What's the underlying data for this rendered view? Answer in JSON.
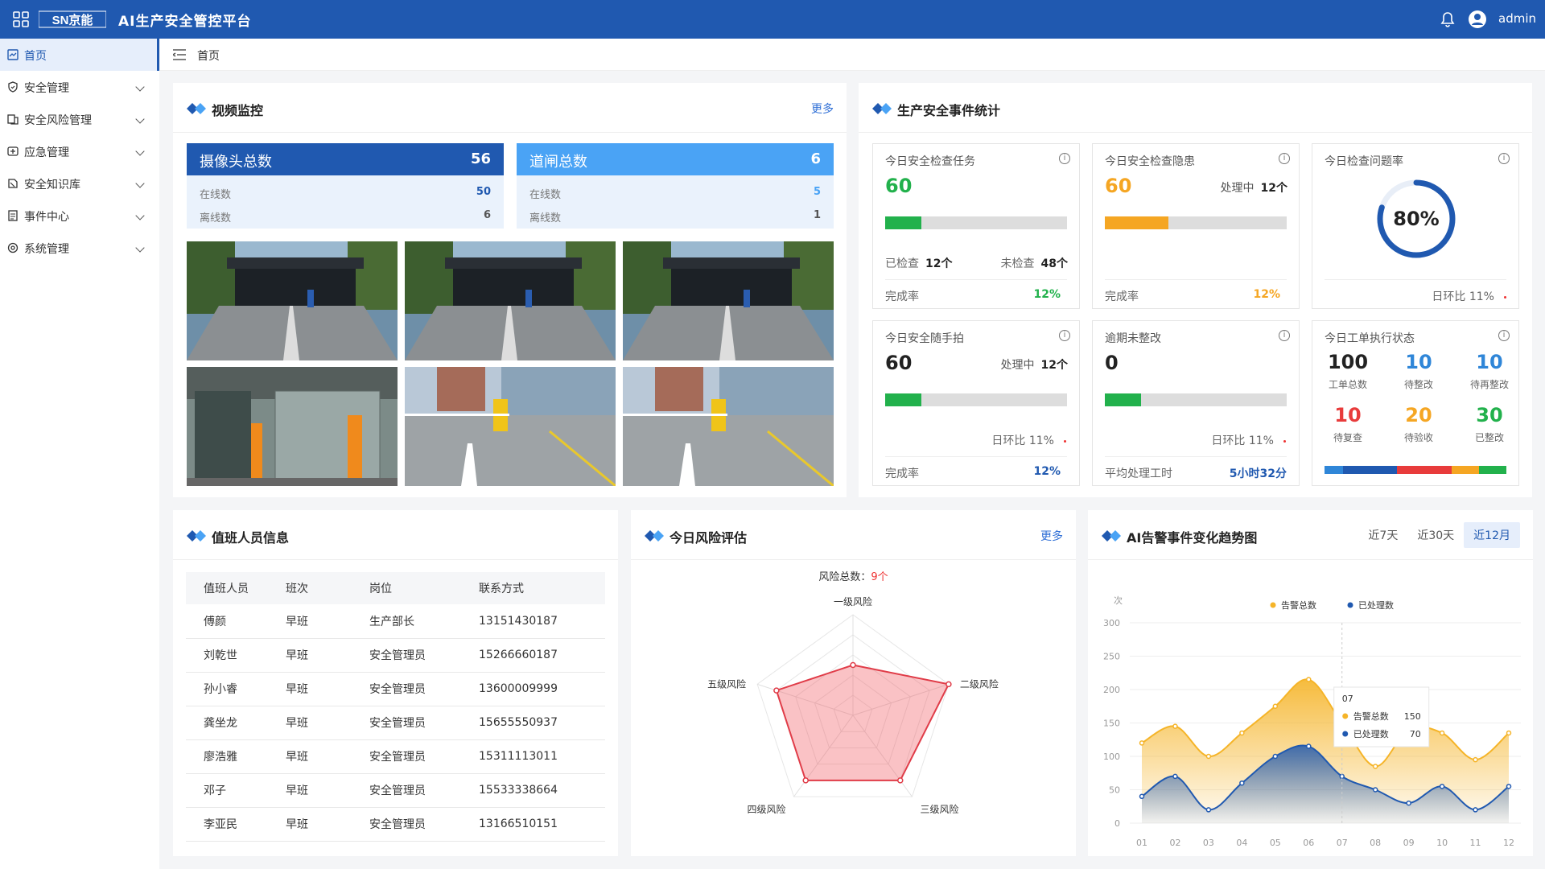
{
  "header": {
    "title": "AI生产安全管控平台",
    "logo_text": "SN京能",
    "user": "admin"
  },
  "sidebar": {
    "items": [
      {
        "label": "首页",
        "icon": "dashboard-icon",
        "active": true
      },
      {
        "label": "安全管理",
        "icon": "shield-icon"
      },
      {
        "label": "安全风险管理",
        "icon": "risk-icon"
      },
      {
        "label": "应急管理",
        "icon": "emergency-icon"
      },
      {
        "label": "安全知识库",
        "icon": "book-icon"
      },
      {
        "label": "事件中心",
        "icon": "document-icon"
      },
      {
        "label": "系统管理",
        "icon": "settings-icon"
      }
    ]
  },
  "breadcrumb": {
    "current": "首页"
  },
  "video": {
    "title": "视频监控",
    "more": "更多",
    "camera": {
      "label": "摄像头总数",
      "total": "56",
      "online_label": "在线数",
      "online": "50",
      "offline_label": "离线数",
      "offline": "6"
    },
    "gate": {
      "label": "道闸总数",
      "total": "6",
      "online_label": "在线数",
      "online": "5",
      "offline_label": "离线数",
      "offline": "1"
    },
    "feeds": [
      "camera-feed-1",
      "camera-feed-2",
      "camera-feed-3",
      "camera-feed-4",
      "camera-feed-5",
      "camera-feed-6"
    ]
  },
  "stats": {
    "title": "生产安全事件统计",
    "c1": {
      "title": "今日安全检查任务",
      "value": "60",
      "progress": 0.2,
      "checked_label": "已检查",
      "checked": "12个",
      "unchecked_label": "未检查",
      "unchecked": "48个",
      "rate_label": "完成率",
      "rate": "12%",
      "color": "#22b14c"
    },
    "c2": {
      "title": "今日安全检查隐患",
      "value": "60",
      "status_label": "处理中",
      "status": "12个",
      "progress": 0.35,
      "rate_label": "完成率",
      "rate": "12%",
      "color": "#f5a623"
    },
    "c3": {
      "title": "今日检查问题率",
      "value": "80%",
      "progress": 0.8,
      "ratio": "日环比 11%",
      "color": "#2059b0"
    },
    "c4": {
      "title": "今日安全随手拍",
      "value": "60",
      "status_label": "处理中",
      "status": "12个",
      "progress": 0.2,
      "ratio": "日环比 11%",
      "rate_label": "完成率",
      "rate": "12%",
      "color": "#22b14c"
    },
    "c5": {
      "title": "逾期未整改",
      "value": "0",
      "progress": 0.2,
      "ratio": "日环比 11%",
      "foot_label": "平均处理工时",
      "foot_value": "5小时32分",
      "color": "#22b14c"
    },
    "c6": {
      "title": "今日工单执行状态",
      "items": [
        {
          "value": "100",
          "label": "工单总数",
          "color": "#222"
        },
        {
          "value": "10",
          "label": "待整改",
          "color": "#2f86d8"
        },
        {
          "value": "10",
          "label": "待再整改",
          "color": "#2f86d8"
        },
        {
          "value": "10",
          "label": "待复查",
          "color": "#e83b3b"
        },
        {
          "value": "20",
          "label": "待验收",
          "color": "#f5a623"
        },
        {
          "value": "30",
          "label": "已整改",
          "color": "#22b14c"
        }
      ],
      "segments": [
        {
          "share": 0.1,
          "color": "#2f86d8"
        },
        {
          "share": 0.3,
          "color": "#2059b0"
        },
        {
          "share": 0.3,
          "color": "#e83b3b"
        },
        {
          "share": 0.15,
          "color": "#f5a623"
        },
        {
          "share": 0.15,
          "color": "#22b14c"
        }
      ]
    }
  },
  "duty": {
    "title": "值班人员信息",
    "columns": [
      "值班人员",
      "班次",
      "岗位",
      "联系方式"
    ],
    "rows": [
      [
        "傅颜",
        "早班",
        "生产部长",
        "13151430187"
      ],
      [
        "刘乾世",
        "早班",
        "安全管理员",
        "15266660187"
      ],
      [
        "孙小睿",
        "早班",
        "安全管理员",
        "13600009999"
      ],
      [
        "龚坐龙",
        "早班",
        "安全管理员",
        "15655550937"
      ],
      [
        "廖浩雅",
        "早班",
        "安全管理员",
        "15311113011"
      ],
      [
        "邓子",
        "早班",
        "安全管理员",
        "15533338664"
      ],
      [
        "李亚民",
        "早班",
        "安全管理员",
        "13166510151"
      ]
    ]
  },
  "risk": {
    "title": "今日风险评估",
    "more": "更多",
    "total_label": "风险总数：",
    "total": "9个",
    "chart_data": {
      "type": "radar",
      "axes": [
        "一级风险",
        "二级风险",
        "三级风险",
        "四级风险",
        "五级风险"
      ],
      "values": [
        0.5,
        1.0,
        0.8,
        0.8,
        0.8
      ],
      "max": 1.0
    }
  },
  "trend": {
    "title": "AI告警事件变化趋势图",
    "tabs": [
      "近7天",
      "近30天",
      "近12月"
    ],
    "active_tab": "近12月",
    "tooltip": {
      "x": "07",
      "rows": [
        {
          "label": "告警总数",
          "value": "150"
        },
        {
          "label": "已处理数",
          "value": "70"
        }
      ]
    },
    "chart_data": {
      "type": "area",
      "unit": "次",
      "x": [
        "01",
        "02",
        "03",
        "04",
        "05",
        "06",
        "07",
        "08",
        "09",
        "10",
        "11",
        "12"
      ],
      "ylim": [
        0,
        300
      ],
      "yticks": [
        0,
        50,
        100,
        150,
        200,
        250,
        300
      ],
      "series": [
        {
          "name": "告警总数",
          "color": "#f5b428",
          "values": [
            120,
            145,
            100,
            135,
            175,
            215,
            150,
            85,
            140,
            135,
            95,
            135
          ]
        },
        {
          "name": "已处理数",
          "color": "#2059b0",
          "values": [
            40,
            70,
            20,
            60,
            100,
            115,
            70,
            50,
            30,
            55,
            20,
            55
          ]
        }
      ]
    }
  }
}
